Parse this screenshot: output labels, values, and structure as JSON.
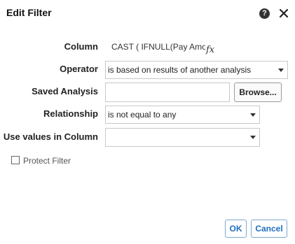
{
  "dialog": {
    "title": "Edit Filter",
    "help_icon": "help-icon",
    "help_glyph": "?",
    "close_icon": "close-icon"
  },
  "form": {
    "column": {
      "label": "Column",
      "value": "CAST ( IFNULL(Pay Amo",
      "fx_glyph": "fx"
    },
    "operator": {
      "label": "Operator",
      "value": "is based on results of another analysis"
    },
    "saved_analysis": {
      "label": "Saved Analysis",
      "value": "",
      "browse_label": "Browse..."
    },
    "relationship": {
      "label": "Relationship",
      "value": "is not equal to any"
    },
    "use_values_in_column": {
      "label": "Use values in Column",
      "value": ""
    },
    "protect_filter": {
      "label": "Protect Filter",
      "checked": false
    }
  },
  "footer": {
    "ok_label": "OK",
    "cancel_label": "Cancel"
  },
  "colors": {
    "accent": "#1f6fbf",
    "button_border": "#7fa7cf"
  }
}
